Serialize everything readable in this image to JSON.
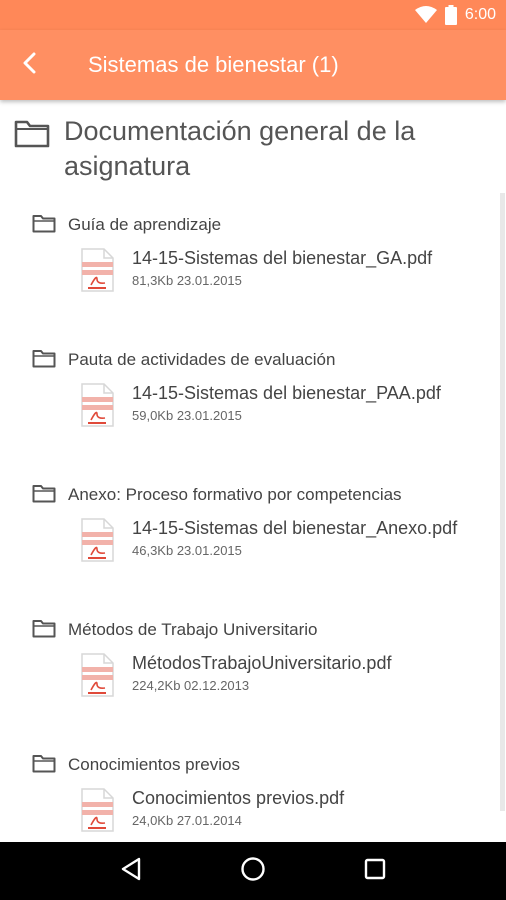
{
  "status_bar": {
    "time": "6:00",
    "icons": [
      "wifi-icon",
      "battery-icon"
    ]
  },
  "app_bar": {
    "title": "Sistemas de bienestar (1)",
    "back_icon": "chevron-left-icon"
  },
  "section": {
    "title": "Documentación general de la asignatura"
  },
  "folders": [
    {
      "name": "Guía de aprendizaje",
      "file": {
        "name": "14-15-Sistemas del bienestar_GA.pdf",
        "meta": "81,3Kb 23.01.2015"
      }
    },
    {
      "name": "Pauta de actividades de evaluación",
      "file": {
        "name": "14-15-Sistemas del bienestar_PAA.pdf",
        "meta": "59,0Kb 23.01.2015"
      }
    },
    {
      "name": "Anexo: Proceso formativo por competencias",
      "file": {
        "name": "14-15-Sistemas del bienestar_Anexo.pdf",
        "meta": "46,3Kb 23.01.2015"
      }
    },
    {
      "name": "Métodos de Trabajo Universitario",
      "file": {
        "name": "MétodosTrabajoUniversitario.pdf",
        "meta": "224,2Kb 02.12.2013"
      }
    },
    {
      "name": "Conocimientos previos",
      "file": {
        "name": "Conocimientos previos.pdf",
        "meta": "24,0Kb 27.01.2014"
      }
    }
  ],
  "colors": {
    "status_bar": "#ff8858",
    "app_bar": "#ff8f62",
    "pdf_accent": "#e04a3a",
    "nav_bar": "#000000"
  },
  "nav": {
    "icons": [
      "back-triangle-icon",
      "home-circle-icon",
      "recents-square-icon"
    ]
  }
}
